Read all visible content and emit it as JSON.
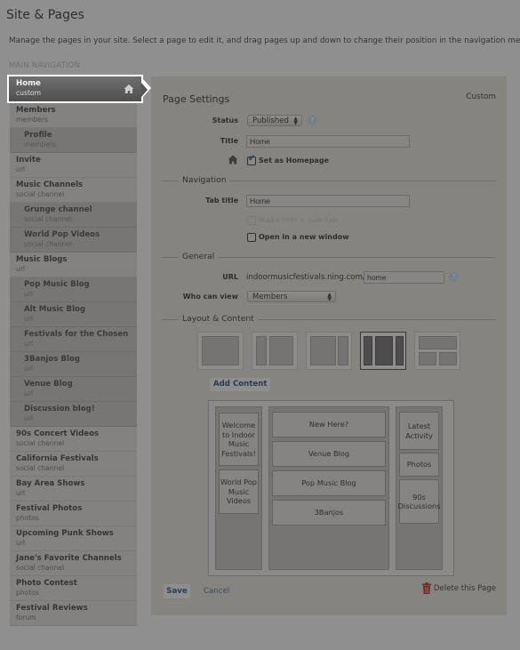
{
  "header": {
    "title": "Site & Pages",
    "intro": "Manage the pages in your site. Select a page to edit it, and drag pages up and down to change their position in the navigation menu.",
    "section_label": "MAIN NAVIGATION"
  },
  "nav": {
    "selected": {
      "name": "Home",
      "type": "custom",
      "icon": "home-icon"
    },
    "items": [
      {
        "name": "Members",
        "type": "members",
        "sub": false
      },
      {
        "name": "Profile",
        "type": "members",
        "sub": true
      },
      {
        "name": "Invite",
        "type": "url",
        "sub": false
      },
      {
        "name": "Music Channels",
        "type": "social channel",
        "sub": false
      },
      {
        "name": "Grunge channel",
        "type": "social channel",
        "sub": true
      },
      {
        "name": "World Pop Videos",
        "type": "social channel",
        "sub": true
      },
      {
        "name": "Music Blogs",
        "type": "url",
        "sub": false
      },
      {
        "name": "Pop Music Blog",
        "type": "url",
        "sub": true
      },
      {
        "name": "Alt Music Blog",
        "type": "url",
        "sub": true
      },
      {
        "name": "Festivals for the Chosen",
        "type": "url",
        "sub": true
      },
      {
        "name": "3Banjos Blog",
        "type": "url",
        "sub": true
      },
      {
        "name": "Venue Blog",
        "type": "url",
        "sub": true
      },
      {
        "name": "Discussion blog!",
        "type": "url",
        "sub": true
      },
      {
        "name": "90s Concert Videos",
        "type": "social channel",
        "sub": false
      },
      {
        "name": "California Festivals",
        "type": "social channel",
        "sub": false
      },
      {
        "name": "Bay Area Shows",
        "type": "url",
        "sub": false
      },
      {
        "name": "Festival Photos",
        "type": "photos",
        "sub": false
      },
      {
        "name": "Upcoming Punk Shows",
        "type": "url",
        "sub": false
      },
      {
        "name": "Jane's Favorite Channels",
        "type": "social channel",
        "sub": false
      },
      {
        "name": "Photo Contest",
        "type": "photos",
        "sub": false
      },
      {
        "name": "Festival Reviews",
        "type": "forum",
        "sub": false
      }
    ]
  },
  "settings": {
    "title": "Page Settings",
    "page_type": "Custom",
    "status_label": "Status",
    "status_value": "Published",
    "title_label": "Title",
    "title_value": "Home",
    "homepage_label": "Set as Homepage",
    "homepage_checked": true,
    "navigation_heading": "Navigation",
    "tab_title_label": "Tab title",
    "tab_title_value": "Home",
    "subtab_label": "Make this a sub-tab",
    "subtab_checked": false,
    "subtab_disabled": true,
    "new_window_label": "Open in a new window",
    "new_window_checked": false,
    "general_heading": "General",
    "url_label": "URL",
    "url_prefix": "indoormusicfestivals.ning.com/",
    "url_value": "home",
    "who_label": "Who can view",
    "who_value": "Members",
    "layout_heading": "Layout & Content",
    "layout_options": [
      "one-column",
      "sidebar-left",
      "sidebar-right",
      "three-column",
      "header-two-column"
    ],
    "selected_layout": "three-column",
    "add_content_label": "Add Content",
    "columns": {
      "left": [
        "Welcome to Indoor Music Festivals!",
        "World Pop Music Videos"
      ],
      "center": [
        "New Here?",
        "Venue Blog",
        "Pop Music Blog",
        "3Banjos"
      ],
      "right": [
        "Latest Activity",
        "Photos",
        "90s Discussions"
      ]
    },
    "save_label": "Save",
    "cancel_label": "Cancel",
    "delete_label": "Delete this Page",
    "help_glyph": "?",
    "check_glyph": "✔",
    "select_arrows": "▲▼"
  },
  "colors": {
    "delete_icon": "#8a1c20",
    "link": "#3a4c63",
    "selected_nav": "#5a5a5a"
  }
}
